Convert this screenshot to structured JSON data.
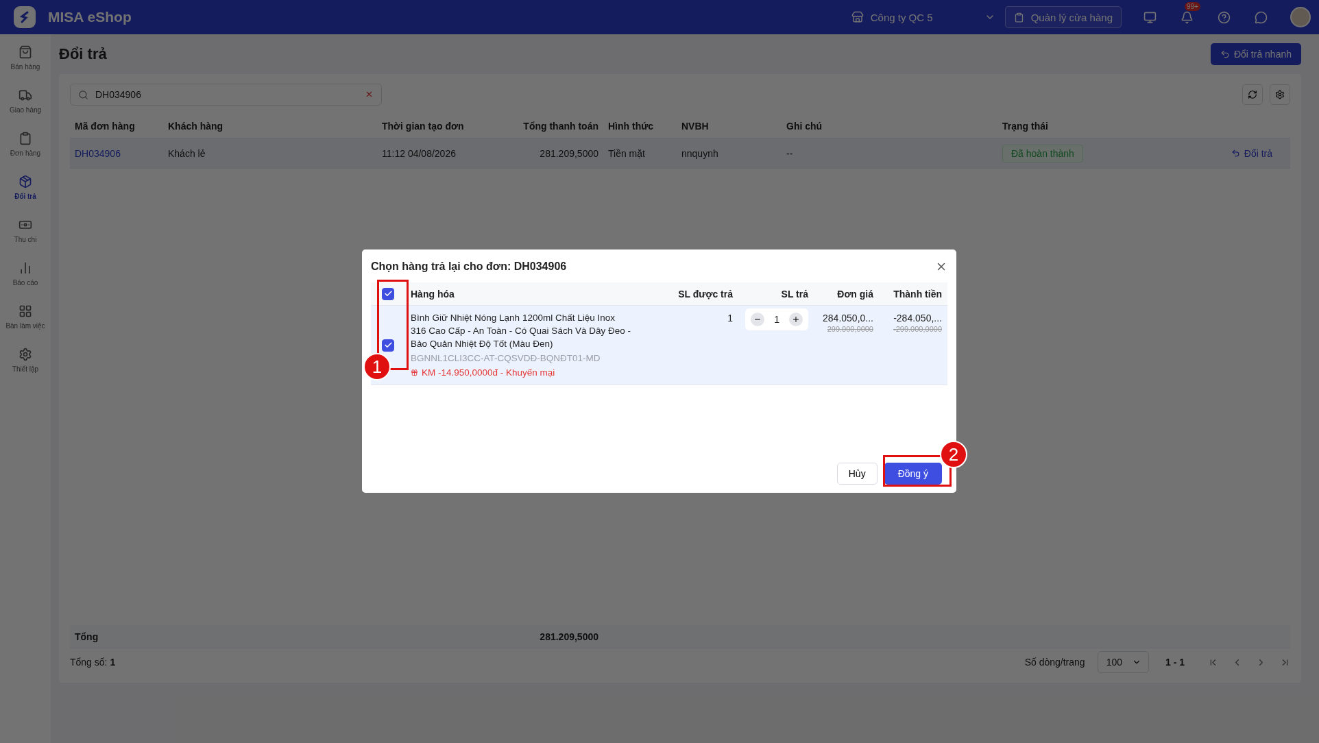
{
  "app": {
    "name": "MISA eShop"
  },
  "topbar": {
    "company": "Công ty QC 5",
    "store_button": "Quản lý cửa hàng",
    "notification_badge": "99+"
  },
  "sidebar": {
    "items": [
      {
        "label": "Bán hàng",
        "selected": false
      },
      {
        "label": "Giao hàng",
        "selected": false
      },
      {
        "label": "Đơn hàng",
        "selected": false
      },
      {
        "label": "Đổi trả",
        "selected": true
      },
      {
        "label": "Thu chi",
        "selected": false
      },
      {
        "label": "Báo cáo",
        "selected": false
      },
      {
        "label": "Bàn làm việc",
        "selected": false
      },
      {
        "label": "Thiết lập",
        "selected": false
      }
    ]
  },
  "page": {
    "title": "Đổi trả",
    "quick_button": "Đổi trả nhanh"
  },
  "search": {
    "value": "DH034906"
  },
  "table": {
    "columns": [
      "Mã đơn hàng",
      "Khách hàng",
      "Thời gian tạo đơn",
      "Tổng thanh toán",
      "Hình thức",
      "NVBH",
      "Ghi chú",
      "Trạng thái"
    ],
    "rows": [
      {
        "order_id": "DH034906",
        "customer": "Khách lẻ",
        "created": "11:12 04/08/2026",
        "total": "281.209,5000",
        "payment": "Tiền mặt",
        "staff": "nnquynh",
        "note": "--",
        "status": "Đã hoàn thành",
        "action": "Đổi trả"
      }
    ]
  },
  "summary": {
    "label": "Tổng",
    "total": "281.209,5000"
  },
  "footer": {
    "count_label": "Tổng số:",
    "count": "1",
    "page_size_label": "Số dòng/trang",
    "page_size": "100",
    "range": "1 - 1"
  },
  "dialog": {
    "title": "Chọn hàng trả lại cho đơn: DH034906",
    "select_all_checked": true,
    "columns": [
      "Hàng hóa",
      "SL được trả",
      "SL trả",
      "Đơn giá",
      "Thành tiền"
    ],
    "items": [
      {
        "checked": true,
        "name": "Bình Giữ Nhiệt Nóng Lạnh 1200ml Chất Liệu Inox 316 Cao Cấp - An Toàn - Có Quai Sách Và Dây Đeo - Bảo Quản Nhiệt Độ Tốt (Màu Đen)",
        "sku": "BGNNL1CLI3CC-AT-CQSVDĐ-BQNĐT01-MD",
        "promotion": "KM -14.950,0000đ - Khuyến mại",
        "returnable": "1",
        "quantity": "1",
        "unit_price": "284.050,0...",
        "unit_price_original": "299.000,0000",
        "amount": "-284.050,...",
        "amount_original": "-299.000,0000"
      }
    ],
    "cancel": "Hủy",
    "confirm": "Đồng ý"
  },
  "annotations": [
    {
      "number": "1"
    },
    {
      "number": "2"
    }
  ]
}
